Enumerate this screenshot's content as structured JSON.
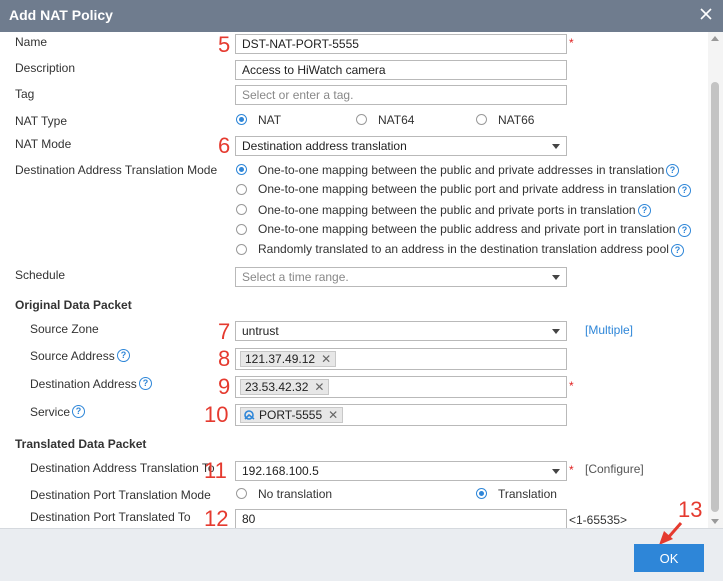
{
  "dialog": {
    "title": "Add NAT Policy",
    "ok_label": "OK"
  },
  "form": {
    "name": {
      "label": "Name",
      "value": "DST-NAT-PORT-5555"
    },
    "description": {
      "label": "Description",
      "value": "Access to HiWatch camera"
    },
    "tag": {
      "label": "Tag",
      "placeholder": "Select or enter a tag."
    },
    "nat_type": {
      "label": "NAT Type",
      "options": [
        "NAT",
        "NAT64",
        "NAT66"
      ],
      "selected": "NAT"
    },
    "nat_mode": {
      "label": "NAT Mode",
      "value": "Destination address translation"
    },
    "dat_mode": {
      "label": "Destination Address Translation Mode",
      "options": [
        "One-to-one mapping between the public and private addresses in translation",
        "One-to-one mapping between the public port and private address in translation",
        "One-to-one mapping between the public and private ports in translation",
        "One-to-one mapping between the public address and private port in translation",
        "Randomly translated to an address in the destination translation address pool"
      ],
      "selected_index": 0
    },
    "schedule": {
      "label": "Schedule",
      "placeholder": "Select a time range."
    },
    "original": {
      "section_title": "Original Data Packet",
      "source_zone": {
        "label": "Source Zone",
        "value": "untrust",
        "link": "[Multiple]"
      },
      "source_address": {
        "label": "Source Address",
        "tag": "121.37.49.12"
      },
      "destination_address": {
        "label": "Destination Address",
        "tag": "23.53.42.32"
      },
      "service": {
        "label": "Service",
        "tag": "PORT-5555"
      }
    },
    "translated": {
      "section_title": "Translated Data Packet",
      "dest_addr_to": {
        "label": "Destination Address Translation To",
        "value": "192.168.100.5",
        "link": "[Configure]"
      },
      "dest_port_mode": {
        "label": "Destination Port Translation Mode",
        "options": [
          "No translation",
          "Translation"
        ],
        "selected": "Translation"
      },
      "dest_port_to": {
        "label": "Destination Port Translated To",
        "value": "80",
        "hint": "<1-65535>"
      }
    }
  },
  "annotations": [
    "5",
    "6",
    "7",
    "8",
    "9",
    "10",
    "11",
    "12",
    "13"
  ],
  "required_mark": "*",
  "help_glyph": "?",
  "remove_glyph": "✕",
  "colors": {
    "titlebar": "#6f7c8e",
    "accent": "#2e86d8",
    "annotation": "#e53a2f"
  }
}
